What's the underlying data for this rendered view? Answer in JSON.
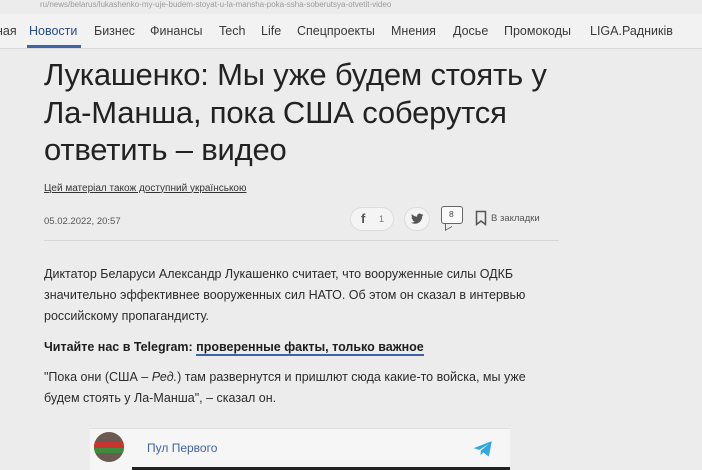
{
  "url": "ru/news/belarus/lukashenko-my-uje-budem-stoyat-u-la-mansha-poka-ssha-soberutsya-otvetit-video",
  "nav": {
    "items": [
      "ная",
      "Новости",
      "Бизнес",
      "Финансы",
      "Tech",
      "Life",
      "Спецпроекты",
      "Мнения",
      "Досье",
      "Промокоды",
      "LIGA.Радників"
    ],
    "active_index": 1
  },
  "article": {
    "headline": "Лукашенко: Мы уже будем стоять у Ла-Манша, пока США соберутся ответить – видео",
    "ua_link": "Цей матеріал також доступний українською",
    "date": "05.02.2022, 20:57",
    "share": {
      "fb_count": "1",
      "comments_count": "8",
      "bookmark_label": "В закладки"
    },
    "lead": "Диктатор Беларуси Александр Лукашенко считает, что вооруженные силы ОДКБ значительно эффективнее вооруженных сил НАТО. Об этом он сказал в интервью российскому пропагандисту.",
    "telegram_prefix": "Читайте нас в Telegram: ",
    "telegram_link": "проверенные факты, только важное",
    "quote_part1": "\"Пока они (США – ",
    "quote_em": "Ред.",
    "quote_part2": ") там развернутся и пришлют сюда какие-то войска, мы уже будем стоять у Ла-Манша\", – сказал он."
  },
  "embed": {
    "channel": "Пул Первого"
  },
  "colors": {
    "accent": "#3f63a8",
    "telegram": "#2ea6e0"
  },
  "icons": [
    "facebook-icon",
    "twitter-icon",
    "comment-icon",
    "bookmark-icon",
    "telegram-icon"
  ]
}
